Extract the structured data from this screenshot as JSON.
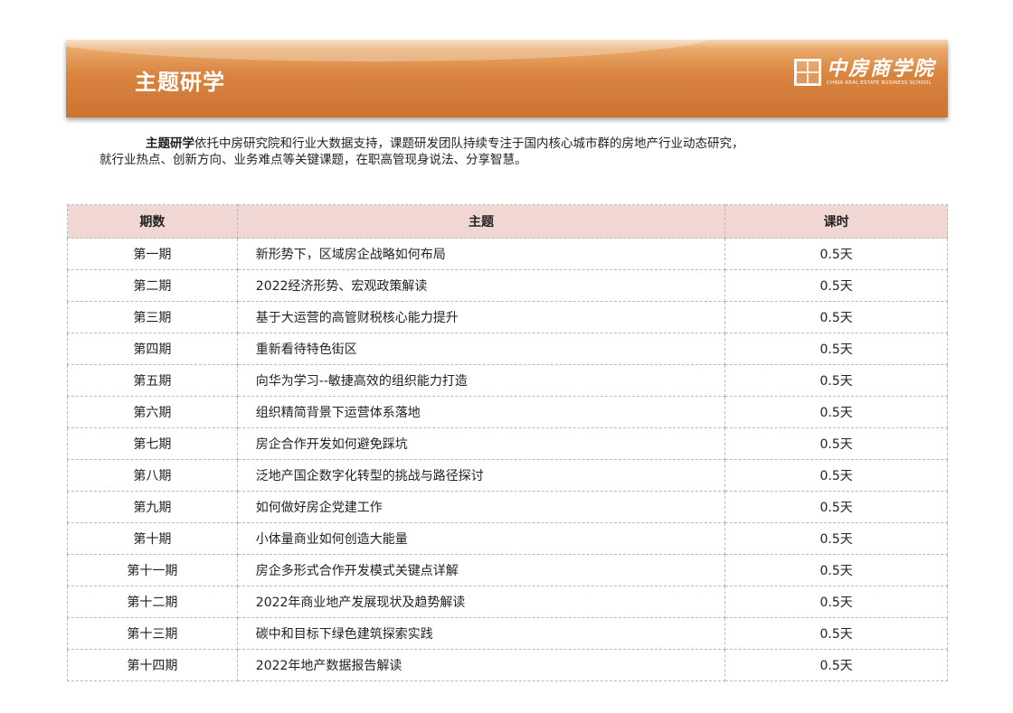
{
  "header": {
    "title": "主题研学",
    "logo_cn": "中房商学院",
    "logo_en": "CHINA REAL ESTATE BUSINESS SCHOOL"
  },
  "intro": {
    "bold_lead": "主题研学",
    "line1_rest": "依托中房研究院和行业大数据支持，课题研发团队持续专注于国内核心城市群的房地产行业动态研究，",
    "line2": "就行业热点、创新方向、业务难点等关键课题，在职高管现身说法、分享智慧。"
  },
  "table": {
    "headers": [
      "期数",
      "主题",
      "课时"
    ],
    "rows": [
      [
        "第一期",
        "新形势下，区域房企战略如何布局",
        "0.5天"
      ],
      [
        "第二期",
        "2022经济形势、宏观政策解读",
        "0.5天"
      ],
      [
        "第三期",
        "基于大运营的高管财税核心能力提升",
        "0.5天"
      ],
      [
        "第四期",
        "重新看待特色街区",
        "0.5天"
      ],
      [
        "第五期",
        "向华为学习--敏捷高效的组织能力打造",
        "0.5天"
      ],
      [
        "第六期",
        "组织精简背景下运营体系落地",
        "0.5天"
      ],
      [
        "第七期",
        "房企合作开发如何避免踩坑",
        "0.5天"
      ],
      [
        "第八期",
        "泛地产国企数字化转型的挑战与路径探讨",
        "0.5天"
      ],
      [
        "第九期",
        "如何做好房企党建工作",
        "0.5天"
      ],
      [
        "第十期",
        "小体量商业如何创造大能量",
        "0.5天"
      ],
      [
        "第十一期",
        "房企多形式合作开发模式关键点详解",
        "0.5天"
      ],
      [
        "第十二期",
        "2022年商业地产发展现状及趋势解读",
        "0.5天"
      ],
      [
        "第十三期",
        "碳中和目标下绿色建筑探索实践",
        "0.5天"
      ],
      [
        "第十四期",
        "2022年地产数据报告解读",
        "0.5天"
      ]
    ]
  }
}
